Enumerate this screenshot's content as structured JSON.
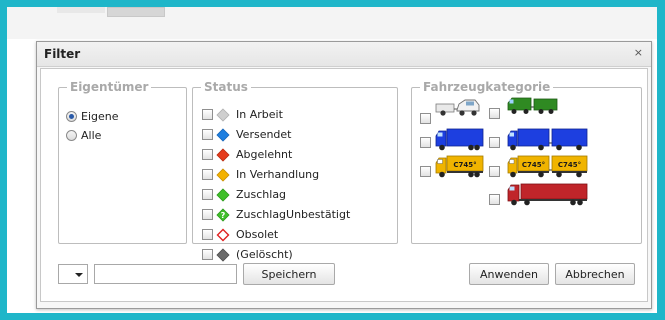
{
  "dialog": {
    "title": "Filter",
    "close_symbol": "×"
  },
  "owner": {
    "legend": "Eigentümer",
    "options": [
      {
        "label": "Eigene",
        "checked": true
      },
      {
        "label": "Alle",
        "checked": false
      }
    ]
  },
  "status": {
    "legend": "Status",
    "items": [
      {
        "label": "In Arbeit",
        "icon": "gray-diamond-icon",
        "color": "#c8c8c8"
      },
      {
        "label": "Versendet",
        "icon": "blue-diamond-icon",
        "color": "#1e7fe0"
      },
      {
        "label": "Abgelehnt",
        "icon": "red-diamond-icon",
        "color": "#e53b1c"
      },
      {
        "label": "In Verhandlung",
        "icon": "yellow-diamond-icon",
        "color": "#f3b200"
      },
      {
        "label": "Zuschlag",
        "icon": "green-diamond-icon",
        "color": "#3fbf2a"
      },
      {
        "label": "ZuschlagUnbestätigt",
        "icon": "green-question-diamond-icon",
        "color": "#3fbf2a"
      },
      {
        "label": "Obsolet",
        "icon": "red-outline-diamond-icon",
        "color": "#e02020"
      },
      {
        "label": "(Gelöscht)",
        "icon": "dark-gray-diamond-icon",
        "color": "#6a6a6a"
      }
    ]
  },
  "vehicle": {
    "legend": "Fahrzeugkategorie",
    "badge_text": "C745°",
    "colors": {
      "green": "#2f8a22",
      "blue": "#1d3fe0",
      "yellow": "#f0b400",
      "red": "#c0252a",
      "white": "#eeeeee"
    },
    "icons": [
      "car-with-trailer-icon",
      "green-van-with-trailer-icon",
      "blue-truck-icon",
      "blue-truck-trailer-icon",
      "yellow-container-truck-icon",
      "yellow-container-truck-trailer-icon",
      "red-semi-truck-icon"
    ]
  },
  "bottom": {
    "filter_name_value": "",
    "save_label": "Speichern",
    "apply_label": "Anwenden",
    "cancel_label": "Abbrechen"
  }
}
